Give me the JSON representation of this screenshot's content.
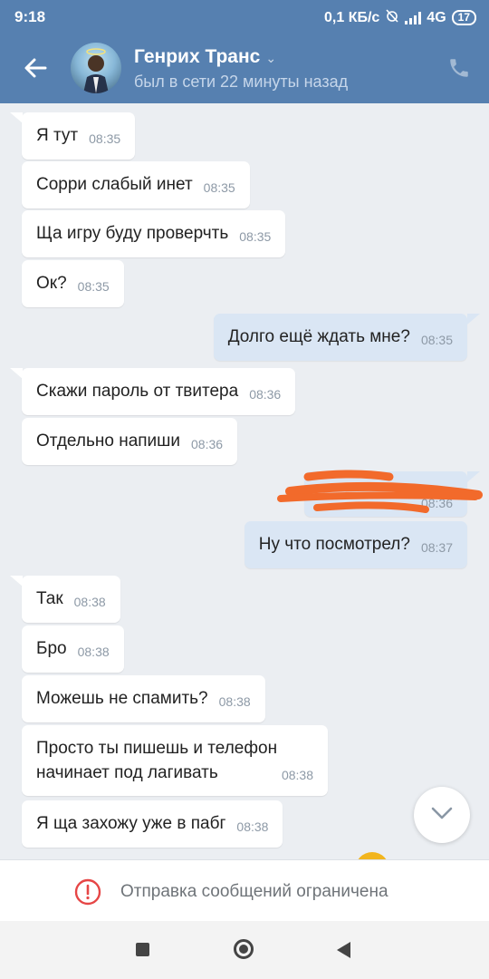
{
  "status_bar": {
    "time": "9:18",
    "speed": "0,1 КБ/с",
    "network": "4G",
    "battery": "17"
  },
  "header": {
    "name": "Генрих Транс",
    "last_seen": "был в сети 22 минуты назад"
  },
  "messages": [
    {
      "dir": "in",
      "text": "Я тут",
      "time": "08:35"
    },
    {
      "dir": "in",
      "text": "Сорри слабый инет",
      "time": "08:35"
    },
    {
      "dir": "in",
      "text": "Ща игру буду проверчть",
      "time": "08:35"
    },
    {
      "dir": "in",
      "text": "Ок?",
      "time": "08:35"
    },
    {
      "dir": "out",
      "text": "Долго ещё ждать мне?",
      "time": "08:35"
    },
    {
      "dir": "in",
      "text": "Скажи пароль от твитера",
      "time": "08:36"
    },
    {
      "dir": "in",
      "text": "Отдельно напиши",
      "time": "08:36"
    },
    {
      "dir": "out",
      "text": "",
      "time": "08:36",
      "redacted": true
    },
    {
      "dir": "out",
      "text": "Ну что посмотрел?",
      "time": "08:37"
    },
    {
      "dir": "in",
      "text": "Так",
      "time": "08:38"
    },
    {
      "dir": "in",
      "text": "Бро",
      "time": "08:38"
    },
    {
      "dir": "in",
      "text": "Можешь не спамить?",
      "time": "08:38"
    },
    {
      "dir": "in",
      "text": "Просто ты пишешь и телефон начинает под лагивать",
      "time": "08:38"
    },
    {
      "dir": "in",
      "text": "Я ща захожу уже в пабг",
      "time": "08:38"
    }
  ],
  "composer": {
    "notice": "Отправка сообщений ограничена"
  },
  "colors": {
    "header": "#5680b0",
    "incoming_bubble": "#ffffff",
    "outgoing_bubble": "#dae6f4",
    "background": "#ebeef2",
    "warning": "#e64646",
    "redaction": "#f26a2b"
  },
  "icons": [
    "back-arrow-icon",
    "phone-icon",
    "chevron-down-icon",
    "warning-icon",
    "scroll-down-icon"
  ]
}
